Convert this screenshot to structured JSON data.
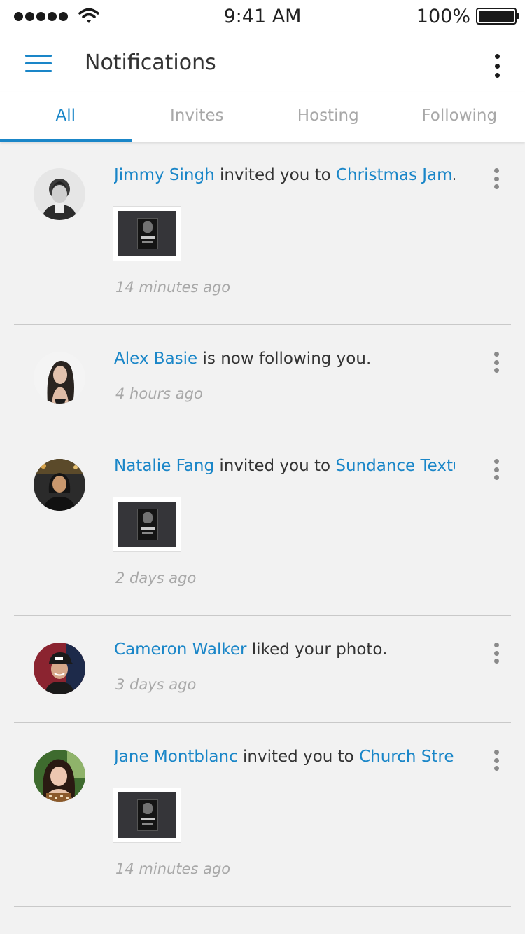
{
  "status_bar": {
    "time": "9:41 AM",
    "battery": "100%"
  },
  "app_bar": {
    "title": "Notifications"
  },
  "tabs": [
    {
      "label": "All",
      "active": true
    },
    {
      "label": "Invites",
      "active": false
    },
    {
      "label": "Hosting",
      "active": false
    },
    {
      "label": "Following",
      "active": false
    }
  ],
  "notifications": [
    {
      "user": "Jimmy Singh",
      "action": " invited you to ",
      "target": "Christmas Jam",
      "suffix": ".",
      "time": "14 minutes ago",
      "has_thumbnail": true
    },
    {
      "user": "Alex Basie",
      "action": " is now following you.",
      "target": "",
      "suffix": "",
      "time": "4 hours ago",
      "has_thumbnail": false
    },
    {
      "user": "Natalie Fang",
      "action": " invited you to ",
      "target": "Sundance Textu...",
      "suffix": "",
      "time": "2 days ago",
      "has_thumbnail": true
    },
    {
      "user": "Cameron Walker",
      "action": " liked your photo.",
      "target": "",
      "suffix": "",
      "time": "3 days ago",
      "has_thumbnail": false
    },
    {
      "user": "Jane Montblanc",
      "action": " invited you to ",
      "target": "Church Stre...",
      "suffix": "",
      "time": "14 minutes ago",
      "has_thumbnail": true
    }
  ],
  "colors": {
    "accent": "#1a86c8",
    "muted": "#a8a8a8",
    "background": "#f2f2f2"
  }
}
